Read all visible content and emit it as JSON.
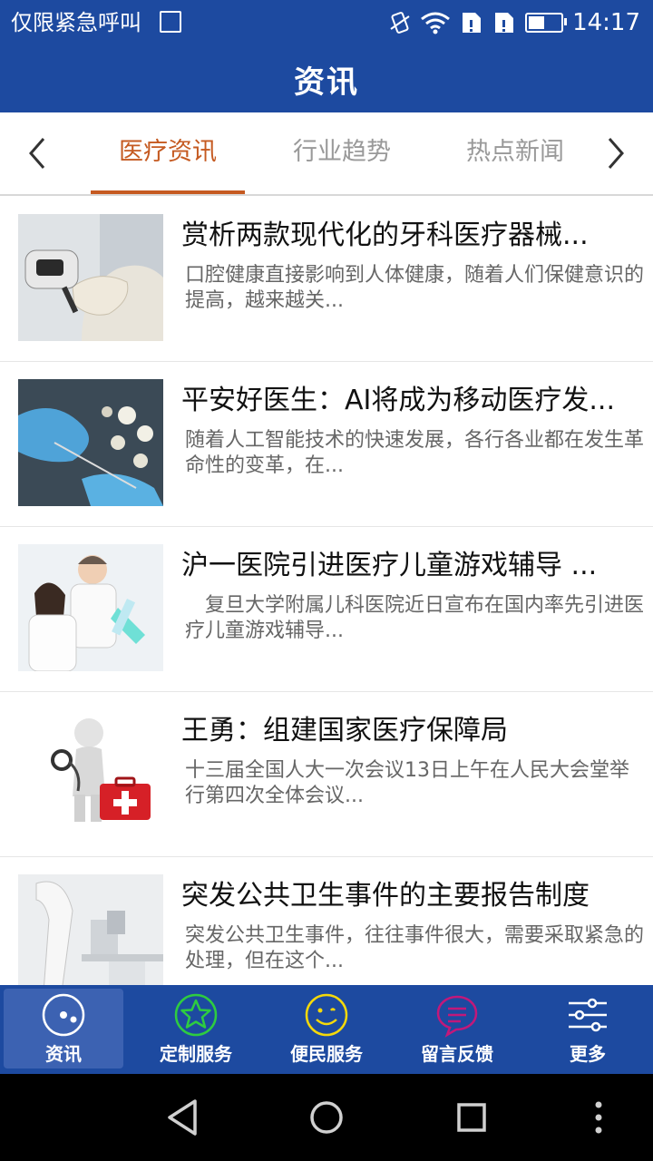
{
  "status_bar": {
    "carrier_text": "仅限紧急呼叫",
    "time": "14:17",
    "battery_level": 0.5,
    "icons": [
      "image-notification-icon",
      "vibrate-icon",
      "wifi-icon",
      "sim-icon",
      "sim-icon",
      "battery-icon"
    ]
  },
  "app_bar": {
    "title": "资讯"
  },
  "tabs": {
    "items": [
      {
        "label": "医疗资讯",
        "active": true
      },
      {
        "label": "行业趋势",
        "active": false
      },
      {
        "label": "热点新闻",
        "active": false
      }
    ],
    "prev_icon": "chevron-left-icon",
    "next_icon": "chevron-right-icon"
  },
  "articles": [
    {
      "title": "赏析两款现代化的牙科医疗器械...",
      "summary": "口腔健康直接影响到人体健康，随着人们保健意识的提高，越来越关..."
    },
    {
      "title": "平安好医生：AI将成为移动医疗发...",
      "summary": "随着人工智能技术的快速发展，各行各业都在发生革命性的变革，在..."
    },
    {
      "title": "沪一医院引进医疗儿童游戏辅导 ...",
      "summary": "　复旦大学附属儿科医院近日宣布在国内率先引进医疗儿童游戏辅导..."
    },
    {
      "title": "王勇：组建国家医疗保障局",
      "summary": "十三届全国人大一次会议13日上午在人民大会堂举行第四次全体会议..."
    },
    {
      "title": "突发公共卫生事件的主要报告制度",
      "summary": "突发公共卫生事件，往往事件很大，需要采取紧急的处理，但在这个..."
    }
  ],
  "bottom_nav": {
    "items": [
      {
        "label": "资讯",
        "icon": "news-icon",
        "active": true
      },
      {
        "label": "定制服务",
        "icon": "star-icon",
        "active": false
      },
      {
        "label": "便民服务",
        "icon": "smile-icon",
        "active": false
      },
      {
        "label": "留言反馈",
        "icon": "message-icon",
        "active": false
      },
      {
        "label": "更多",
        "icon": "sliders-icon",
        "active": false
      }
    ]
  },
  "system_nav": {
    "icons": [
      "back-icon",
      "home-icon",
      "recents-icon",
      "overflow-icon"
    ]
  },
  "colors": {
    "primary": "#1d4aa0",
    "accent": "#c55a21",
    "nav_active": "#3c62b2",
    "star_green": "#2ecc40",
    "smile_yellow": "#f5d90a",
    "message_magenta": "#c2187a"
  }
}
